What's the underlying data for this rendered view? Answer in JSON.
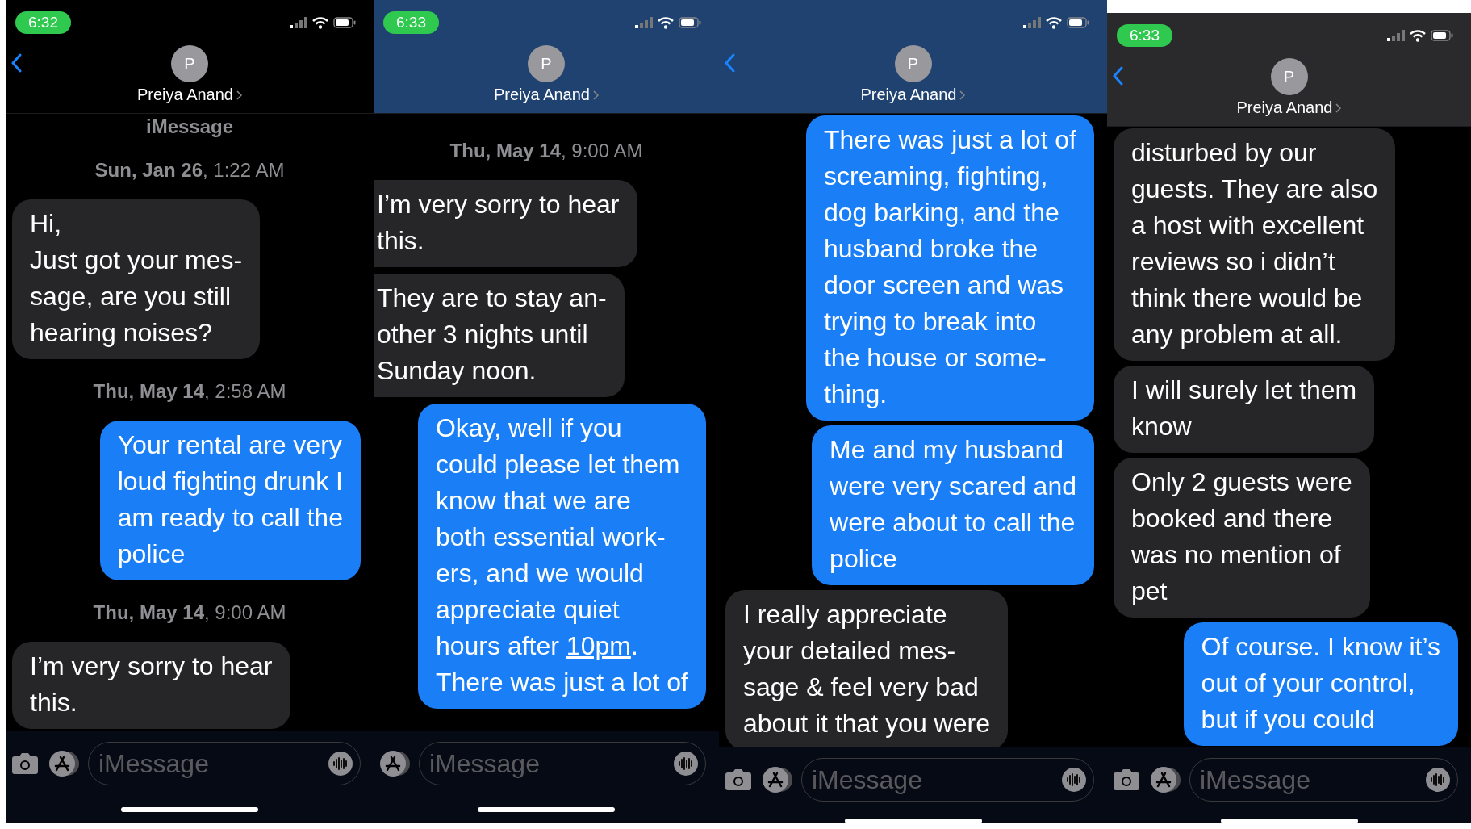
{
  "screens": [
    {
      "time": "6:32",
      "has_back_button": true,
      "has_camera_button": true,
      "contact": {
        "initial": "P",
        "name": "Preiya Anand"
      },
      "messages": [
        {
          "kind": "service",
          "text": "iMessage"
        },
        {
          "kind": "date",
          "text": "**Sun, Jan 26**, 1:22 AM"
        },
        {
          "kind": "incoming",
          "text": "Hi,\nJust got your mes-\nsage, are you still\nhearing noises?"
        },
        {
          "kind": "date",
          "text": "**Thu, May 14**, 2:58 AM"
        },
        {
          "kind": "outgoing",
          "text": "Your rental are very\nloud fighting drunk I\nam ready to call the\npolice"
        },
        {
          "kind": "date",
          "text": "**Thu, May 14**, 9:00 AM"
        },
        {
          "kind": "incoming",
          "text": "I’m very sorry to hear\nthis."
        }
      ],
      "input_placeholder": "iMessage"
    },
    {
      "time": "6:33",
      "has_back_button": false,
      "has_camera_button": false,
      "contact": {
        "initial": "P",
        "name": "Preiya Anand"
      },
      "messages": [
        {
          "kind": "date",
          "text": "**Thu, May 14**, 9:00 AM"
        },
        {
          "kind": "incoming",
          "text": "I’m very sorry to hear\nthis."
        },
        {
          "kind": "incoming",
          "text": "They are to stay an-\nother 3 nights until\nSunday noon."
        },
        {
          "kind": "outgoing",
          "parts": [
            {
              "text": "Okay, well if you\ncould please let them\nknow that we are\nboth essential work-\ners, and we would\nappreciate quiet\nhours after ",
              "link": false
            },
            {
              "text": "10pm",
              "link": true
            },
            {
              "text": ".\nThere was just a lot of",
              "link": false
            }
          ]
        }
      ],
      "input_placeholder": "iMessage"
    },
    {
      "has_back_button": true,
      "has_camera_button": true,
      "contact": {
        "initial": "P",
        "name": "Preiya Anand"
      },
      "messages": [
        {
          "kind": "outgoing",
          "text": "There was just a lot of\nscreaming, fighting,\ndog barking, and the\nhusband broke the\ndoor screen and was\ntrying to break into\nthe house or some-\nthing."
        },
        {
          "kind": "outgoing",
          "text": "Me and my husband\nwere very scared and\nwere about to call the\npolice"
        },
        {
          "kind": "incoming",
          "text": "I really appreciate\nyour detailed mes-\nsage & feel very bad\nabout it that you were"
        }
      ],
      "input_placeholder": "iMessage"
    },
    {
      "time": "6:33",
      "has_back_button": true,
      "has_camera_button": true,
      "contact": {
        "initial": "P",
        "name": "Preiya Anand"
      },
      "messages": [
        {
          "kind": "incoming",
          "text": "disturbed by our\nguests. They are also\na host with excellent\nreviews so i didn’t\nthink there would be\nany problem at all."
        },
        {
          "kind": "incoming",
          "text": "I will surely let them\nknow"
        },
        {
          "kind": "incoming",
          "text": "Only 2 guests were\nbooked and there\nwas no mention of\npet"
        },
        {
          "kind": "outgoing",
          "text": "Of course. I know it’s\nout of your control,\nbut if you could"
        }
      ],
      "input_placeholder": "iMessage"
    }
  ]
}
